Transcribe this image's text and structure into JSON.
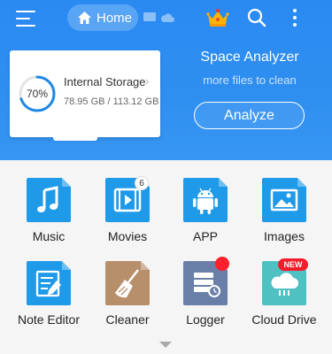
{
  "topbar": {
    "home_label": "Home"
  },
  "storage": {
    "percent_label": "70%",
    "percent_used": 0.7,
    "title": "Internal Storage",
    "size": "78.95 GB / 113.12 GB"
  },
  "analyzer": {
    "title": "Space Analyzer",
    "subtitle": "more files to clean",
    "button_label": "Analyze"
  },
  "tools": [
    {
      "label": "Music",
      "icon": "music-icon",
      "color": "#1f9ae8"
    },
    {
      "label": "Movies",
      "icon": "movie-icon",
      "color": "#1f9ae8",
      "badge": "6"
    },
    {
      "label": "APP",
      "icon": "android-icon",
      "color": "#1f9ae8"
    },
    {
      "label": "Images",
      "icon": "image-icon",
      "color": "#1f9ae8"
    },
    {
      "label": "Note Editor",
      "icon": "note-editor-icon",
      "color": "#1f9ae8"
    },
    {
      "label": "Cleaner",
      "icon": "broom-icon",
      "color": "#b78f6a"
    },
    {
      "label": "Logger",
      "icon": "logger-icon",
      "color": "#6a7fa8"
    },
    {
      "label": "Cloud Drive",
      "icon": "cloud-drive-icon",
      "color": "#4fc1c3",
      "badge": "NEW"
    }
  ],
  "colors": {
    "header_blue": "#2f8ff0",
    "ring_blue": "#1e88e5",
    "badge_red": "#f21d2b"
  }
}
